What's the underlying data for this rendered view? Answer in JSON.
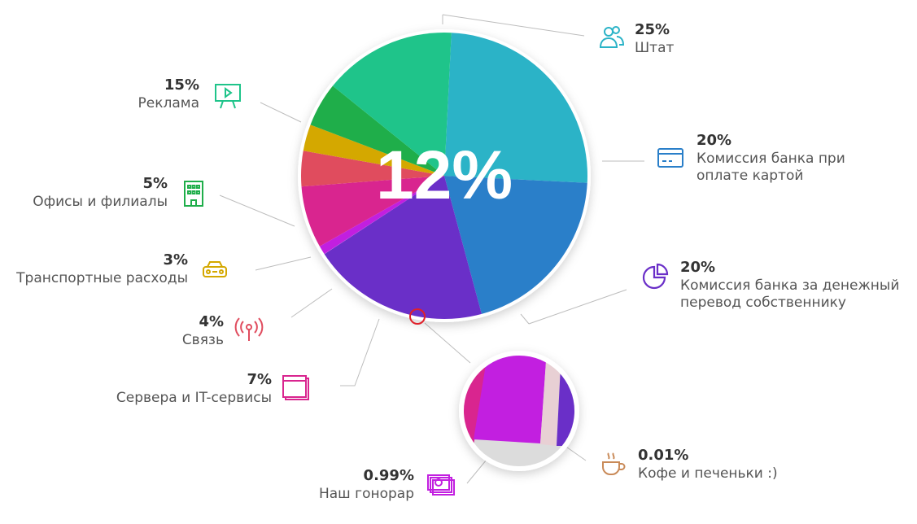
{
  "chart_data": {
    "type": "pie",
    "center_label": "12%",
    "slices": [
      {
        "label": "Штат",
        "value": 25,
        "value_label": "25%",
        "color": "#2bb3c7",
        "icon": "people-icon"
      },
      {
        "label": "Комиссия банка при оплате картой",
        "value": 20,
        "value_label": "20%",
        "color": "#2a7fc9",
        "icon": "credit-card-icon",
        "lines": [
          "Комиссия банка при",
          "оплате картой"
        ]
      },
      {
        "label": "Комиссия банка за денежный перевод собственнику",
        "value": 20,
        "value_label": "20%",
        "color": "#6a2fc8",
        "icon": "pie-chart-icon",
        "lines": [
          "Комиссия банка за денежный",
          "перевод собственнику"
        ]
      },
      {
        "label": "Кофе и печеньки  :)",
        "value": 0.01,
        "value_label": "0.01%",
        "color": "#e8d0d4",
        "icon": "coffee-cup-icon"
      },
      {
        "label": "Наш гонорар",
        "value": 0.99,
        "value_label": "0.99%",
        "color": "#c21fe0",
        "icon": "money-icon"
      },
      {
        "label": "Сервера и IT-сервисы",
        "value": 7,
        "value_label": "7%",
        "color": "#d9258f",
        "icon": "browser-window-icon"
      },
      {
        "label": "Связь",
        "value": 4,
        "value_label": "4%",
        "color": "#e04c5e",
        "icon": "antenna-icon"
      },
      {
        "label": "Транспортные расходы",
        "value": 3,
        "value_label": "3%",
        "color": "#d4a800",
        "icon": "car-icon"
      },
      {
        "label": "Офисы и филиалы",
        "value": 5,
        "value_label": "5%",
        "color": "#1fae4a",
        "icon": "office-building-icon"
      },
      {
        "label": "Реклама",
        "value": 15,
        "value_label": "15%",
        "color": "#1fc48a",
        "icon": "presentation-board-icon"
      }
    ]
  }
}
